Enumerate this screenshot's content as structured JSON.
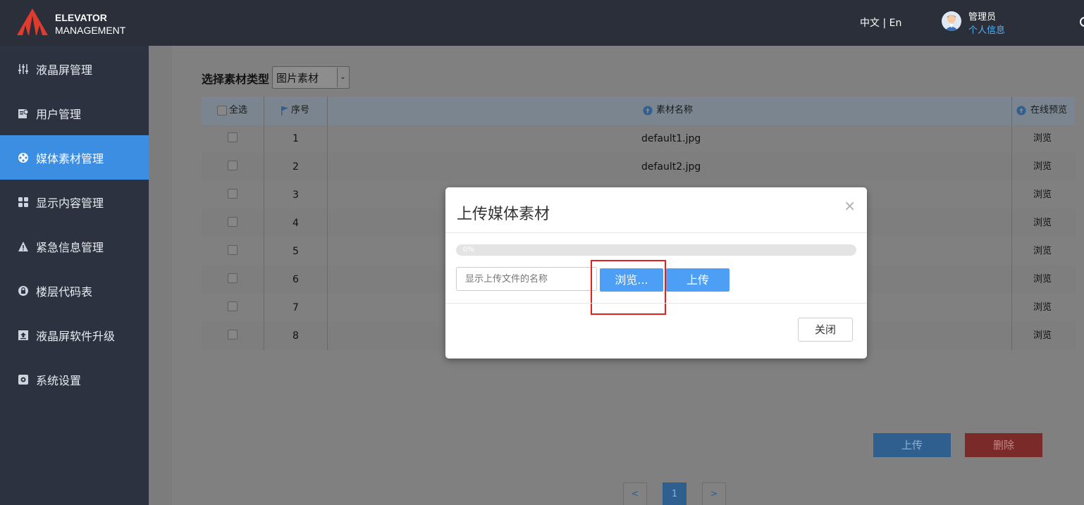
{
  "header": {
    "logo_line1": "ELEVATOR",
    "logo_line2": "MANAGEMENT",
    "language": "中文 | En",
    "user_role": "管理员",
    "user_link": "个人信息"
  },
  "sidebar": {
    "items": [
      {
        "label": "液晶屏管理",
        "icon": "sliders-icon"
      },
      {
        "label": "用户管理",
        "icon": "user-card-icon"
      },
      {
        "label": "媒体素材管理",
        "icon": "film-reel-icon",
        "active": true
      },
      {
        "label": "显示内容管理",
        "icon": "grid-icon"
      },
      {
        "label": "紧急信息管理",
        "icon": "warning-icon"
      },
      {
        "label": "楼层代码表",
        "icon": "lock-icon"
      },
      {
        "label": "液晶屏软件升级",
        "icon": "upload-icon"
      },
      {
        "label": "系统设置",
        "icon": "gear-icon"
      }
    ]
  },
  "filter": {
    "label": "选择素材类型",
    "selected": "图片素材"
  },
  "table": {
    "headers": {
      "select_all": "全选",
      "index": "序号",
      "name": "素材名称",
      "preview": "在线预览"
    },
    "rows": [
      {
        "index": "1",
        "name": "default1.jpg",
        "preview": "浏览"
      },
      {
        "index": "2",
        "name": "default2.jpg",
        "preview": "浏览"
      },
      {
        "index": "3",
        "name": "",
        "preview": "浏览"
      },
      {
        "index": "4",
        "name": "",
        "preview": "浏览"
      },
      {
        "index": "5",
        "name": "",
        "preview": "浏览"
      },
      {
        "index": "6",
        "name": "",
        "preview": "浏览"
      },
      {
        "index": "7",
        "name": "",
        "preview": "浏览"
      },
      {
        "index": "8",
        "name": "",
        "preview": "浏览"
      }
    ]
  },
  "actions": {
    "upload": "上传",
    "delete": "删除"
  },
  "pagination": {
    "prev": "<",
    "current": "1",
    "next": ">"
  },
  "modal": {
    "title": "上传媒体素材",
    "close_x": "×",
    "progress": 0,
    "progress_text": "0%",
    "file_placeholder": "显示上传文件的名称",
    "browse": "浏览...",
    "upload": "上传",
    "close": "关闭"
  },
  "colors": {
    "topbar": "#2a2f3a",
    "sidebar": "#2d3240",
    "active": "#3c8ee2",
    "primary": "#4d9ff5",
    "highlight": "#e31f1f"
  }
}
